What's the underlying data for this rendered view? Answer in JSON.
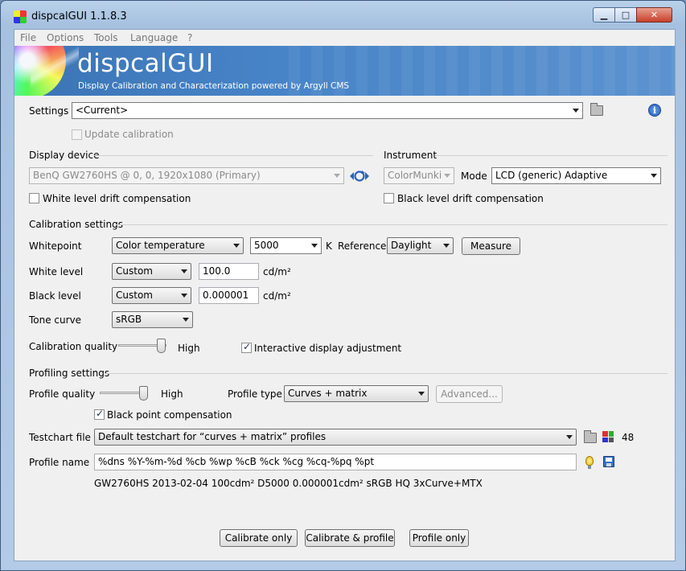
{
  "window": {
    "title": "dispcalGUI 1.1.8.3",
    "min_label": "▁",
    "max_label": "□",
    "close_label": "✕"
  },
  "menu": [
    "File",
    "Options",
    "Tools",
    "Language",
    "?"
  ],
  "banner": {
    "title": "dispcalGUI",
    "subtitle": "Display Calibration and Characterization powered by Argyll CMS"
  },
  "settings": {
    "label": "Settings",
    "value": "<Current>",
    "update_calibration": "Update calibration"
  },
  "display": {
    "heading": "Display device",
    "device": "BenQ GW2760HS @ 0, 0, 1920x1080 (Primary)",
    "white_drift": "White level drift compensation"
  },
  "instrument": {
    "heading": "Instrument",
    "device": "ColorMunki",
    "mode_label": "Mode",
    "mode_value": "LCD (generic) Adaptive",
    "black_drift": "Black level drift compensation"
  },
  "calibration": {
    "heading": "Calibration settings",
    "whitepoint_label": "Whitepoint",
    "whitepoint_mode": "Color temperature",
    "whitepoint_value": "5000",
    "kelvin_unit": "K",
    "reference_label": "Reference",
    "reference_value": "Daylight",
    "measure_button": "Measure",
    "white_level_label": "White level",
    "white_level_mode": "Custom",
    "white_level_value": "100.0",
    "white_level_unit": "cd/m²",
    "black_level_label": "Black level",
    "black_level_mode": "Custom",
    "black_level_value": "0.000001",
    "black_level_unit": "cd/m²",
    "tone_curve_label": "Tone curve",
    "tone_curve_value": "sRGB",
    "quality_label": "Calibration quality",
    "quality_value": "High",
    "interactive_label": "Interactive display adjustment"
  },
  "profiling": {
    "heading": "Profiling settings",
    "quality_label": "Profile quality",
    "quality_value": "High",
    "type_label": "Profile type",
    "type_value": "Curves + matrix",
    "advanced_button": "Advanced...",
    "bpc_label": "Black point compensation",
    "testchart_label": "Testchart file",
    "testchart_value": "Default testchart for “curves + matrix” profiles",
    "patch_count": "48",
    "profile_name_label": "Profile name",
    "profile_name_value": "%dns %Y-%m-%d %cb %wp %cB %ck %cg %cq-%pq %pt",
    "profile_name_preview": "GW2760HS 2013-02-04 100cdm² D5000 0.000001cdm² sRGB HQ 3xCurve+MTX"
  },
  "actions": {
    "calibrate_only": "Calibrate only",
    "calibrate_profile": "Calibrate & profile",
    "profile_only": "Profile only"
  },
  "colors": {
    "banner_blue": "#4784c7",
    "window_frame": "#a6c1e0",
    "close_red": "#c7402a"
  }
}
